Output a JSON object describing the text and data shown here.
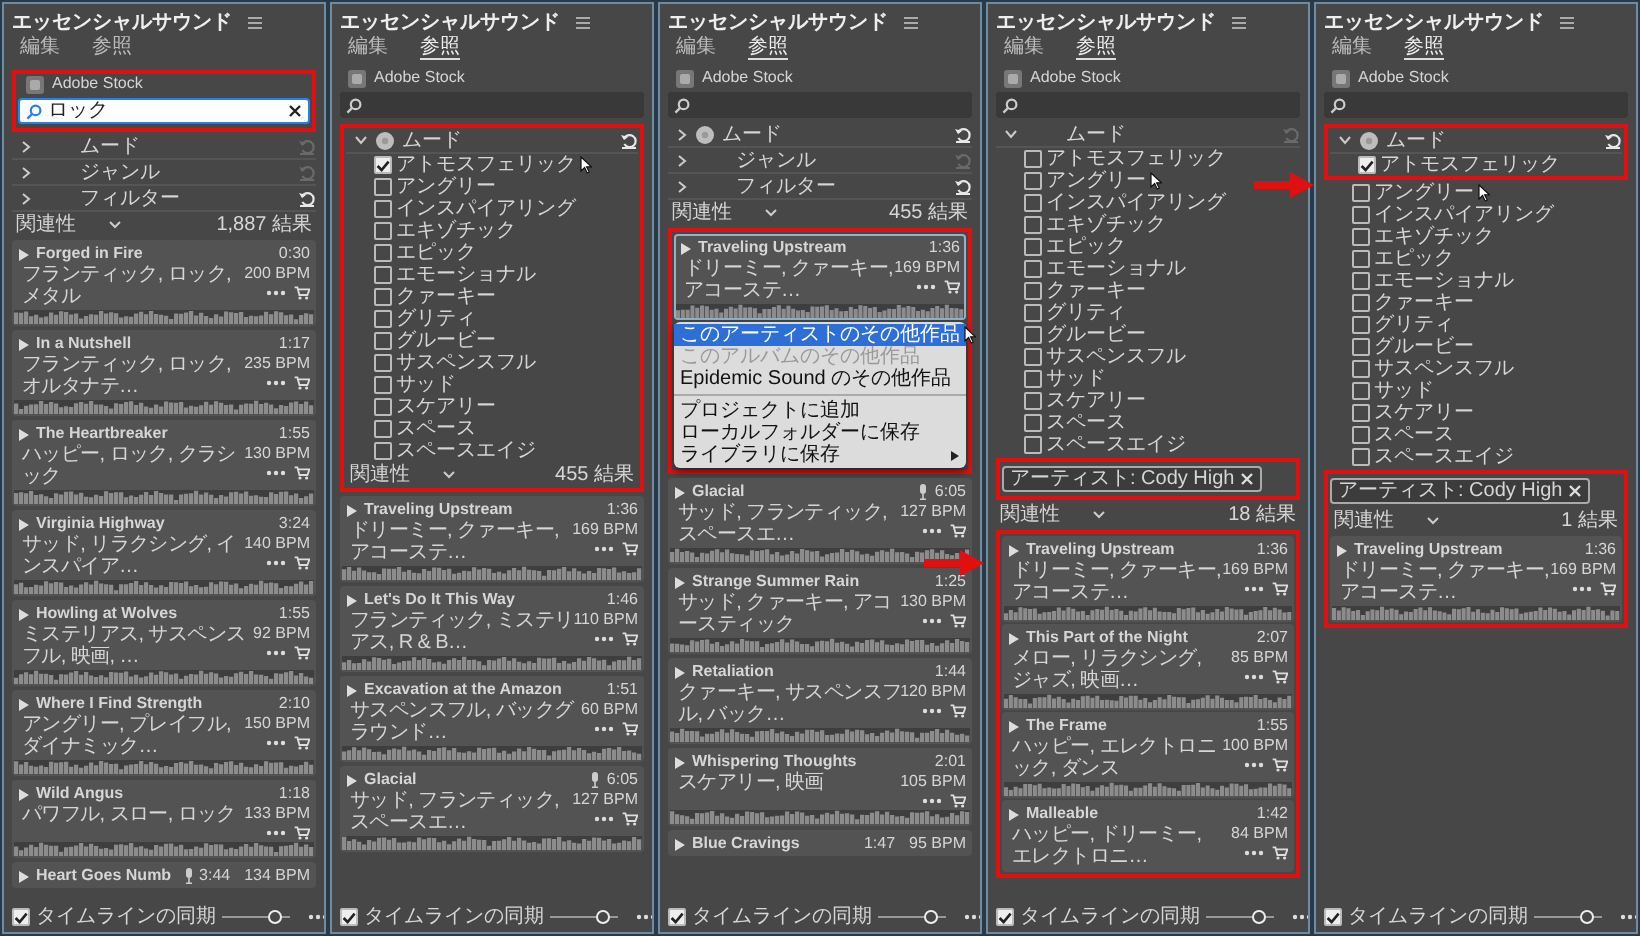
{
  "panels": [
    {
      "sections": [
        {
          "kind": "title",
          "text": "エッセンシャルサウンド"
        },
        {
          "kind": "tabs",
          "tabs": [
            {
              "label": "編集",
              "selected": false
            },
            {
              "label": "参照",
              "selected": false
            }
          ]
        },
        {
          "kind": "highlight",
          "children": [
            {
              "kind": "source",
              "label": "Adobe Stock"
            },
            {
              "kind": "search",
              "value": "ロック",
              "focused": true
            }
          ]
        },
        {
          "kind": "filter",
          "label": "ムード",
          "expanded": false,
          "badge": false,
          "reset_enabled": false
        },
        {
          "kind": "filter",
          "label": "ジャンル",
          "expanded": false,
          "badge": false,
          "reset_enabled": false
        },
        {
          "kind": "filter",
          "label": "フィルター",
          "expanded": false,
          "badge": false,
          "reset_enabled": true
        },
        {
          "kind": "sort",
          "label": "関連性",
          "count": "1,887 結果"
        },
        {
          "kind": "track",
          "title": "Forged in Fire",
          "duration": "0:30",
          "bpm": "200 BPM",
          "tags": "フランティック, ロック, メタル",
          "vocal": false,
          "selected": false,
          "waveform": true
        },
        {
          "kind": "track",
          "title": "In a Nutshell",
          "duration": "1:17",
          "bpm": "235 BPM",
          "tags": "フランティック, ロック, オルタナテ…",
          "vocal": false,
          "selected": false,
          "waveform": true
        },
        {
          "kind": "track",
          "title": "The Heartbreaker",
          "duration": "1:55",
          "bpm": "130 BPM",
          "tags": "ハッピー, ロック, クラシック",
          "vocal": false,
          "selected": false,
          "waveform": true
        },
        {
          "kind": "track",
          "title": "Virginia Highway",
          "duration": "3:24",
          "bpm": "140 BPM",
          "tags": "サッド, リラクシング, インスパイア…",
          "vocal": false,
          "selected": false,
          "waveform": true
        },
        {
          "kind": "track",
          "title": "Howling at Wolves",
          "duration": "1:55",
          "bpm": "92 BPM",
          "tags": "ミステリアス, サスペンスフル, 映画, …",
          "vocal": false,
          "selected": false,
          "waveform": true
        },
        {
          "kind": "track",
          "title": "Where I Find Strength",
          "duration": "2:10",
          "bpm": "150 BPM",
          "tags": "アングリー, プレイフル, ダイナミック…",
          "vocal": false,
          "selected": false,
          "waveform": true
        },
        {
          "kind": "track",
          "title": "Wild Angus",
          "duration": "1:18",
          "bpm": "133 BPM",
          "tags": "パワフル, スロー, ロック",
          "vocal": false,
          "selected": false,
          "waveform": true
        },
        {
          "kind": "track",
          "title": "Heart Goes Numb",
          "duration": "3:44",
          "bpm": "134 BPM",
          "vocal": true,
          "selected": false,
          "waveform": false
        },
        {
          "kind": "footer",
          "label": "タイムラインの同期",
          "checked": true,
          "level": 0.75
        }
      ]
    },
    {
      "sections": [
        {
          "kind": "title",
          "text": "エッセンシャルサウンド"
        },
        {
          "kind": "tabs",
          "tabs": [
            {
              "label": "編集",
              "selected": false
            },
            {
              "label": "参照",
              "selected": true
            }
          ]
        },
        {
          "kind": "source",
          "label": "Adobe Stock"
        },
        {
          "kind": "search",
          "focused": false
        },
        {
          "kind": "highlight",
          "children": [
            {
              "kind": "filter",
              "label": "ムード",
              "expanded": true,
              "badge": true,
              "reset_enabled": true
            },
            {
              "kind": "option",
              "label": "アトモスフェリック",
              "checked": true,
              "cursor": true
            },
            {
              "kind": "option",
              "label": "アングリー",
              "checked": false
            },
            {
              "kind": "option",
              "label": "インスパイアリング",
              "checked": false
            },
            {
              "kind": "option",
              "label": "エキゾチック",
              "checked": false
            },
            {
              "kind": "option",
              "label": "エピック",
              "checked": false
            },
            {
              "kind": "option",
              "label": "エモーショナル",
              "checked": false
            },
            {
              "kind": "option",
              "label": "クァーキー",
              "checked": false
            },
            {
              "kind": "option",
              "label": "グリティ",
              "checked": false
            },
            {
              "kind": "option",
              "label": "グルービー",
              "checked": false
            },
            {
              "kind": "option",
              "label": "サスペンスフル",
              "checked": false
            },
            {
              "kind": "option",
              "label": "サッド",
              "checked": false
            },
            {
              "kind": "option",
              "label": "スケアリー",
              "checked": false
            },
            {
              "kind": "option",
              "label": "スペース",
              "checked": false
            },
            {
              "kind": "option",
              "label": "スペースエイジ",
              "checked": false
            },
            {
              "kind": "sort",
              "label": "関連性",
              "count": "455 結果"
            }
          ]
        },
        {
          "kind": "track",
          "title": "Traveling Upstream",
          "duration": "1:36",
          "bpm": "169 BPM",
          "tags": "ドリーミー, クァーキー, アコーステ…",
          "vocal": false,
          "selected": false,
          "waveform": true
        },
        {
          "kind": "track",
          "title": "Let's Do It This Way",
          "duration": "1:46",
          "bpm": "110 BPM",
          "tags": "フランティック, ミステリアス, R & B…",
          "vocal": false,
          "selected": false,
          "waveform": true
        },
        {
          "kind": "track",
          "title": "Excavation at the Amazon",
          "duration": "1:51",
          "bpm": "60 BPM",
          "tags": "サスペンスフル, バックグラウンド…",
          "vocal": false,
          "selected": false,
          "waveform": true
        },
        {
          "kind": "track",
          "title": "Glacial",
          "duration": "6:05",
          "bpm": "127 BPM",
          "tags": "サッド, フランティック, スペースエ…",
          "vocal": true,
          "selected": false,
          "waveform": true
        },
        {
          "kind": "footer",
          "label": "タイムラインの同期",
          "checked": true,
          "level": 0.75
        }
      ]
    },
    {
      "sections": [
        {
          "kind": "title",
          "text": "エッセンシャルサウンド"
        },
        {
          "kind": "tabs",
          "tabs": [
            {
              "label": "編集",
              "selected": false
            },
            {
              "label": "参照",
              "selected": true
            }
          ]
        },
        {
          "kind": "source",
          "label": "Adobe Stock"
        },
        {
          "kind": "search",
          "focused": false
        },
        {
          "kind": "filter",
          "label": "ムード",
          "expanded": false,
          "badge": true,
          "reset_enabled": true
        },
        {
          "kind": "filter",
          "label": "ジャンル",
          "expanded": false,
          "badge": false,
          "reset_enabled": false
        },
        {
          "kind": "filter",
          "label": "フィルター",
          "expanded": false,
          "badge": false,
          "reset_enabled": true
        },
        {
          "kind": "sort",
          "label": "関連性",
          "count": "455 結果"
        },
        {
          "kind": "highlight",
          "children": [
            {
              "kind": "track",
              "title": "Traveling Upstream",
              "duration": "1:36",
              "bpm": "169 BPM",
              "tags": "ドリーミー, クァーキー, アコーステ…",
              "vocal": false,
              "selected": true,
              "waveform": true
            },
            {
              "kind": "menu",
              "items": [
                {
                  "kind": "item",
                  "label": "このアーティストのその他作品",
                  "highlighted": true,
                  "disabled": false,
                  "submenu": false,
                  "cursor": true
                },
                {
                  "kind": "item",
                  "label": "このアルバムのその他作品",
                  "highlighted": false,
                  "disabled": true,
                  "submenu": false
                },
                {
                  "kind": "item",
                  "label": "Epidemic Sound のその他作品",
                  "highlighted": false,
                  "disabled": false,
                  "submenu": false
                },
                {
                  "kind": "separator"
                },
                {
                  "kind": "item",
                  "label": "プロジェクトに追加",
                  "highlighted": false,
                  "disabled": false,
                  "submenu": false
                },
                {
                  "kind": "item",
                  "label": "ローカルフォルダーに保存",
                  "highlighted": false,
                  "disabled": false,
                  "submenu": false
                },
                {
                  "kind": "item",
                  "label": "ライブラリに保存",
                  "highlighted": false,
                  "disabled": false,
                  "submenu": true
                }
              ]
            }
          ]
        },
        {
          "kind": "track",
          "title": "Glacial",
          "duration": "6:05",
          "bpm": "127 BPM",
          "tags": "サッド, フランティック, スペースエ…",
          "vocal": true,
          "selected": false,
          "waveform": true
        },
        {
          "kind": "track",
          "title": "Strange Summer Rain",
          "duration": "1:25",
          "bpm": "130 BPM",
          "tags": "サッド, クァーキー, アコースティック",
          "vocal": false,
          "selected": false,
          "waveform": true
        },
        {
          "kind": "track",
          "title": "Retaliation",
          "duration": "1:44",
          "bpm": "120 BPM",
          "tags": "クァーキー, サスペンスフル, バック…",
          "vocal": false,
          "selected": false,
          "waveform": true
        },
        {
          "kind": "track",
          "title": "Whispering Thoughts",
          "duration": "2:01",
          "bpm": "105 BPM",
          "tags": "スケアリー, 映画",
          "vocal": false,
          "selected": false,
          "waveform": true
        },
        {
          "kind": "track",
          "title": "Blue Cravings",
          "duration": "1:47",
          "bpm": "95 BPM",
          "vocal": false,
          "selected": false,
          "waveform": false
        },
        {
          "kind": "footer",
          "label": "タイムラインの同期",
          "checked": true,
          "level": 0.75
        }
      ]
    },
    {
      "sections": [
        {
          "kind": "title",
          "text": "エッセンシャルサウンド"
        },
        {
          "kind": "tabs",
          "tabs": [
            {
              "label": "編集",
              "selected": false
            },
            {
              "label": "参照",
              "selected": true
            }
          ]
        },
        {
          "kind": "source",
          "label": "Adobe Stock"
        },
        {
          "kind": "search",
          "focused": false
        },
        {
          "kind": "filter",
          "label": "ムード",
          "expanded": true,
          "badge": false,
          "reset_enabled": false
        },
        {
          "kind": "option",
          "label": "アトモスフェリック",
          "checked": false
        },
        {
          "kind": "option",
          "label": "アングリー",
          "checked": false,
          "cursor": true
        },
        {
          "kind": "option",
          "label": "インスパイアリング",
          "checked": false
        },
        {
          "kind": "option",
          "label": "エキゾチック",
          "checked": false
        },
        {
          "kind": "option",
          "label": "エピック",
          "checked": false
        },
        {
          "kind": "option",
          "label": "エモーショナル",
          "checked": false
        },
        {
          "kind": "option",
          "label": "クァーキー",
          "checked": false
        },
        {
          "kind": "option",
          "label": "グリティ",
          "checked": false
        },
        {
          "kind": "option",
          "label": "グルービー",
          "checked": false
        },
        {
          "kind": "option",
          "label": "サスペンスフル",
          "checked": false
        },
        {
          "kind": "option",
          "label": "サッド",
          "checked": false
        },
        {
          "kind": "option",
          "label": "スケアリー",
          "checked": false
        },
        {
          "kind": "option",
          "label": "スペース",
          "checked": false
        },
        {
          "kind": "option",
          "label": "スペースエイジ",
          "checked": false
        },
        {
          "kind": "highlight",
          "children": [
            {
              "kind": "chip",
              "label": "アーティスト: Cody High"
            }
          ]
        },
        {
          "kind": "sort",
          "label": "関連性",
          "count": "18 結果"
        },
        {
          "kind": "highlight",
          "children": [
            {
              "kind": "track",
              "title": "Traveling Upstream",
              "duration": "1:36",
              "bpm": "169 BPM",
              "tags": "ドリーミー, クァーキー, アコーステ…",
              "vocal": false,
              "selected": false,
              "waveform": true
            },
            {
              "kind": "track",
              "title": "This Part of the Night",
              "duration": "2:07",
              "bpm": "85 BPM",
              "tags": "メロー, リラクシング, ジャズ, 映画…",
              "vocal": false,
              "selected": false,
              "waveform": true
            },
            {
              "kind": "track",
              "title": "The Frame",
              "duration": "1:55",
              "bpm": "100 BPM",
              "tags": "ハッピー, エレクトロニック, ダンス",
              "vocal": false,
              "selected": false,
              "waveform": true
            },
            {
              "kind": "track",
              "title": "Malleable",
              "duration": "1:42",
              "bpm": "84 BPM",
              "tags": "ハッピー, ドリーミー, エレクトロニ…",
              "vocal": false,
              "selected": false,
              "waveform": false
            }
          ]
        },
        {
          "kind": "footer",
          "label": "タイムラインの同期",
          "checked": true,
          "level": 0.75
        }
      ]
    },
    {
      "sections": [
        {
          "kind": "title",
          "text": "エッセンシャルサウンド"
        },
        {
          "kind": "tabs",
          "tabs": [
            {
              "label": "編集",
              "selected": false
            },
            {
              "label": "参照",
              "selected": true
            }
          ]
        },
        {
          "kind": "source",
          "label": "Adobe Stock"
        },
        {
          "kind": "search",
          "focused": false
        },
        {
          "kind": "highlight",
          "children": [
            {
              "kind": "filter",
              "label": "ムード",
              "expanded": true,
              "badge": true,
              "reset_enabled": true
            },
            {
              "kind": "option",
              "label": "アトモスフェリック",
              "checked": true
            }
          ]
        },
        {
          "kind": "option",
          "label": "アングリー",
          "checked": false,
          "cursor": true
        },
        {
          "kind": "option",
          "label": "インスパイアリング",
          "checked": false
        },
        {
          "kind": "option",
          "label": "エキゾチック",
          "checked": false
        },
        {
          "kind": "option",
          "label": "エピック",
          "checked": false
        },
        {
          "kind": "option",
          "label": "エモーショナル",
          "checked": false
        },
        {
          "kind": "option",
          "label": "クァーキー",
          "checked": false
        },
        {
          "kind": "option",
          "label": "グリティ",
          "checked": false
        },
        {
          "kind": "option",
          "label": "グルービー",
          "checked": false
        },
        {
          "kind": "option",
          "label": "サスペンスフル",
          "checked": false
        },
        {
          "kind": "option",
          "label": "サッド",
          "checked": false
        },
        {
          "kind": "option",
          "label": "スケアリー",
          "checked": false
        },
        {
          "kind": "option",
          "label": "スペース",
          "checked": false
        },
        {
          "kind": "option",
          "label": "スペースエイジ",
          "checked": false
        },
        {
          "kind": "highlight",
          "children": [
            {
              "kind": "chip",
              "label": "アーティスト: Cody High"
            },
            {
              "kind": "sort",
              "label": "関連性",
              "count": "1 結果"
            },
            {
              "kind": "track",
              "title": "Traveling Upstream",
              "duration": "1:36",
              "bpm": "169 BPM",
              "tags": "ドリーミー, クァーキー, アコーステ…",
              "vocal": false,
              "selected": false,
              "waveform": true
            }
          ]
        },
        {
          "kind": "footer",
          "label": "タイムラインの同期",
          "checked": true,
          "level": 0.75
        }
      ]
    }
  ]
}
